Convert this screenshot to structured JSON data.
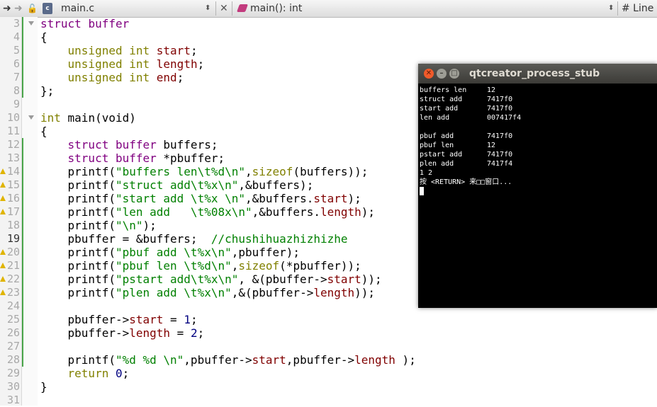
{
  "toolbar": {
    "file_tab": "main.c",
    "func_selector": "main(): int",
    "line_label": "# Line",
    "file_icon_letter": "c"
  },
  "editor": {
    "lines": [
      {
        "n": "3",
        "tokens": [
          [
            "t",
            "struct"
          ],
          [
            "",
            " "
          ],
          [
            "t",
            "buffer"
          ]
        ]
      },
      {
        "n": "4",
        "tokens": [
          [
            "",
            "{"
          ]
        ]
      },
      {
        "n": "5",
        "tokens": [
          [
            "",
            "    "
          ],
          [
            "k",
            "unsigned"
          ],
          [
            "",
            ""
          ],
          [
            "",
            " "
          ],
          [
            "k",
            "int"
          ],
          [
            "",
            " "
          ],
          [
            "m",
            "start"
          ],
          [
            "",
            ";"
          ]
        ]
      },
      {
        "n": "6",
        "tokens": [
          [
            "",
            "    "
          ],
          [
            "k",
            "unsigned"
          ],
          [
            "",
            " "
          ],
          [
            "k",
            "int"
          ],
          [
            "",
            " "
          ],
          [
            "m",
            "length"
          ],
          [
            "",
            ";"
          ]
        ]
      },
      {
        "n": "7",
        "tokens": [
          [
            "",
            "    "
          ],
          [
            "k",
            "unsigned"
          ],
          [
            "",
            " "
          ],
          [
            "k",
            "int"
          ],
          [
            "",
            " "
          ],
          [
            "m",
            "end"
          ],
          [
            "",
            ";"
          ]
        ]
      },
      {
        "n": "8",
        "tokens": [
          [
            "",
            "};"
          ]
        ]
      },
      {
        "n": "9",
        "tokens": []
      },
      {
        "n": "10",
        "tokens": [
          [
            "k",
            "int"
          ],
          [
            "",
            " main(void)"
          ]
        ]
      },
      {
        "n": "11",
        "tokens": [
          [
            "",
            "{"
          ]
        ]
      },
      {
        "n": "12",
        "tokens": [
          [
            "",
            "    "
          ],
          [
            "t",
            "struct"
          ],
          [
            "",
            " "
          ],
          [
            "t",
            "buffer"
          ],
          [
            "",
            " buffers;"
          ]
        ]
      },
      {
        "n": "13",
        "tokens": [
          [
            "",
            "    "
          ],
          [
            "t",
            "struct"
          ],
          [
            "",
            " "
          ],
          [
            "t",
            "buffer"
          ],
          [
            "",
            " *pbuffer;"
          ]
        ]
      },
      {
        "n": "14",
        "tokens": [
          [
            "",
            "    printf("
          ],
          [
            "s",
            "\"buffers len\\t%d\\n\""
          ],
          [
            "",
            ","
          ],
          [
            "k",
            "sizeof"
          ],
          [
            "",
            "(buffers));"
          ]
        ]
      },
      {
        "n": "15",
        "tokens": [
          [
            "",
            "    printf("
          ],
          [
            "s",
            "\"struct add\\t%x\\n\""
          ],
          [
            "",
            ",&buffers);"
          ]
        ]
      },
      {
        "n": "16",
        "tokens": [
          [
            "",
            "    printf("
          ],
          [
            "s",
            "\"start add \\t%x \\n\""
          ],
          [
            "",
            ",&buffers."
          ],
          [
            "m",
            "start"
          ],
          [
            "",
            ");"
          ]
        ]
      },
      {
        "n": "17",
        "tokens": [
          [
            "",
            "    printf("
          ],
          [
            "s",
            "\"len add   \\t%08x\\n\""
          ],
          [
            "",
            ",&buffers."
          ],
          [
            "m",
            "length"
          ],
          [
            "",
            ");"
          ]
        ]
      },
      {
        "n": "18",
        "tokens": [
          [
            "",
            "    printf("
          ],
          [
            "s",
            "\"\\n\""
          ],
          [
            "",
            ");"
          ]
        ]
      },
      {
        "n": "19",
        "tokens": [
          [
            "",
            "    pbuffer = &buffers;  "
          ],
          [
            "c",
            "//chushihuazhizhizhe"
          ]
        ]
      },
      {
        "n": "20",
        "tokens": [
          [
            "",
            "    printf("
          ],
          [
            "s",
            "\"pbuf add \\t%x\\n\""
          ],
          [
            "",
            ",pbuffer);"
          ]
        ]
      },
      {
        "n": "21",
        "tokens": [
          [
            "",
            "    printf("
          ],
          [
            "s",
            "\"pbuf len \\t%d\\n\""
          ],
          [
            "",
            ","
          ],
          [
            "k",
            "sizeof"
          ],
          [
            "",
            "(*pbuffer));"
          ]
        ]
      },
      {
        "n": "22",
        "tokens": [
          [
            "",
            "    printf("
          ],
          [
            "s",
            "\"pstart add\\t%x\\n\""
          ],
          [
            "",
            ", &(pbuffer->"
          ],
          [
            "m",
            "start"
          ],
          [
            "",
            "));"
          ]
        ]
      },
      {
        "n": "23",
        "tokens": [
          [
            "",
            "    printf("
          ],
          [
            "s",
            "\"plen add \\t%x\\n\""
          ],
          [
            "",
            ",&(pbuffer->"
          ],
          [
            "m",
            "length"
          ],
          [
            "",
            "));"
          ]
        ]
      },
      {
        "n": "24",
        "tokens": []
      },
      {
        "n": "25",
        "tokens": [
          [
            "",
            "    pbuffer->"
          ],
          [
            "m",
            "start"
          ],
          [
            "",
            " = "
          ],
          [
            "n",
            "1"
          ],
          [
            "",
            ";"
          ]
        ]
      },
      {
        "n": "26",
        "tokens": [
          [
            "",
            "    pbuffer->"
          ],
          [
            "m",
            "length"
          ],
          [
            "",
            " = "
          ],
          [
            "n",
            "2"
          ],
          [
            "",
            ";"
          ]
        ]
      },
      {
        "n": "27",
        "tokens": []
      },
      {
        "n": "28",
        "tokens": [
          [
            "",
            "    printf("
          ],
          [
            "s",
            "\"%d %d \\n\""
          ],
          [
            "",
            ",pbuffer->"
          ],
          [
            "m",
            "start"
          ],
          [
            "",
            ",pbuffer->"
          ],
          [
            "m",
            "length"
          ],
          [
            "",
            " );"
          ]
        ]
      },
      {
        "n": "29",
        "tokens": [
          [
            "",
            "    "
          ],
          [
            "k",
            "return"
          ],
          [
            "",
            " "
          ],
          [
            "n",
            "0"
          ],
          [
            "",
            ";"
          ]
        ]
      },
      {
        "n": "30",
        "tokens": [
          [
            "",
            "}"
          ]
        ]
      },
      {
        "n": "31",
        "tokens": []
      }
    ]
  },
  "terminal": {
    "title": "qtcreator_process_stub",
    "lines": [
      {
        "label": "buffers len",
        "value": "12"
      },
      {
        "label": "struct add",
        "value": "7417f0"
      },
      {
        "label": "start add",
        "value": "7417f0"
      },
      {
        "label": "len add",
        "value": "007417f4"
      },
      {
        "label": "",
        "value": ""
      },
      {
        "label": "pbuf add",
        "value": "7417f0"
      },
      {
        "label": "pbuf len",
        "value": "12"
      },
      {
        "label": "pstart add",
        "value": "7417f0"
      },
      {
        "label": "plen add",
        "value": "7417f4"
      },
      {
        "label": "1 2",
        "value": ""
      },
      {
        "label": "按 <RETURN> 来□□窗口...",
        "value": ""
      }
    ]
  }
}
